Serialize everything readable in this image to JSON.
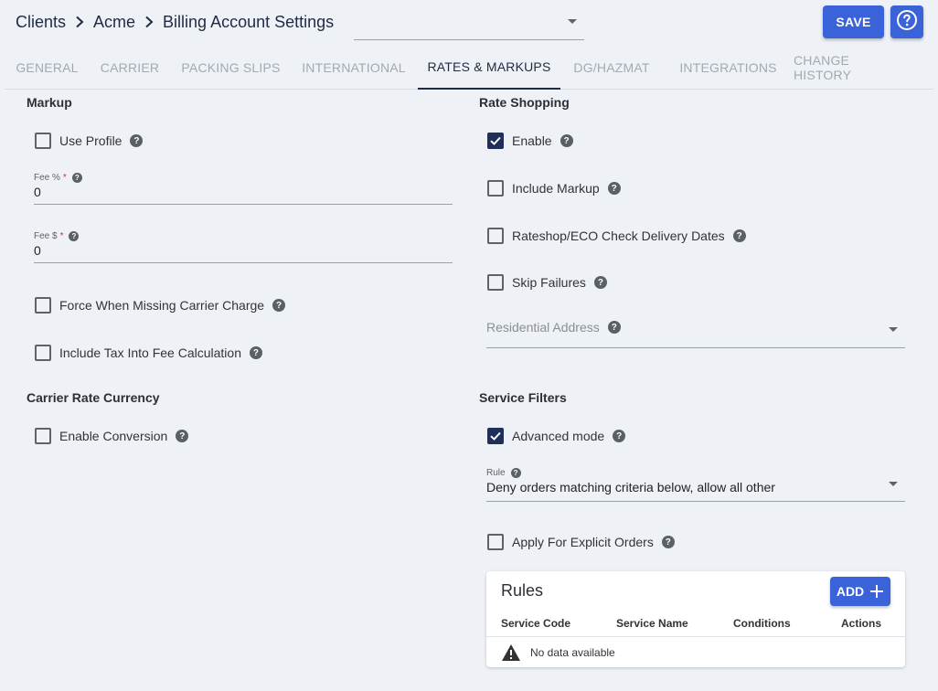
{
  "breadcrumb": {
    "items": [
      "Clients",
      "Acme"
    ],
    "current": "Billing Account Settings"
  },
  "header": {
    "save_label": "SAVE"
  },
  "tabs": [
    {
      "label": "GENERAL"
    },
    {
      "label": "CARRIER"
    },
    {
      "label": "PACKING SLIPS"
    },
    {
      "label": "INTERNATIONAL"
    },
    {
      "label": "RATES & MARKUPS",
      "active": true
    },
    {
      "label": "DG/HAZMAT"
    },
    {
      "label": "INTEGRATIONS"
    },
    {
      "label": "CHANGE HISTORY"
    }
  ],
  "markup": {
    "title": "Markup",
    "use_profile": {
      "label": "Use Profile",
      "checked": false
    },
    "fee_percent": {
      "label": "Fee %",
      "required": "*",
      "value": "0"
    },
    "fee_dollar": {
      "label": "Fee $",
      "required": "*",
      "value": "0"
    },
    "force_missing": {
      "label": "Force When Missing Carrier Charge",
      "checked": false
    },
    "include_tax": {
      "label": "Include Tax Into Fee Calculation",
      "checked": false
    }
  },
  "carrier_rate_currency": {
    "title": "Carrier Rate Currency",
    "enable_conversion": {
      "label": "Enable Conversion",
      "checked": false
    }
  },
  "rate_shopping": {
    "title": "Rate Shopping",
    "enable": {
      "label": "Enable",
      "checked": true
    },
    "include_markup": {
      "label": "Include Markup",
      "checked": false
    },
    "check_delivery": {
      "label": "Rateshop/ECO Check Delivery Dates",
      "checked": false
    },
    "skip_failures": {
      "label": "Skip Failures",
      "checked": false
    },
    "residential_address": {
      "placeholder": "Residential Address"
    }
  },
  "service_filters": {
    "title": "Service Filters",
    "advanced_mode": {
      "label": "Advanced mode",
      "checked": true
    },
    "rule": {
      "label": "Rule",
      "value": "Deny orders matching criteria below, allow all other"
    },
    "apply_explicit": {
      "label": "Apply For Explicit Orders",
      "checked": false
    }
  },
  "rules_table": {
    "title": "Rules",
    "add_label": "ADD",
    "columns": [
      "Service Code",
      "Service Name",
      "Conditions",
      "Actions"
    ],
    "empty_text": "No data available"
  },
  "colors": {
    "primary": "#3b63d9",
    "checkbox_checked": "#1f2f5a",
    "background": "#eef1f6",
    "active_tab": "#1f2a44"
  }
}
